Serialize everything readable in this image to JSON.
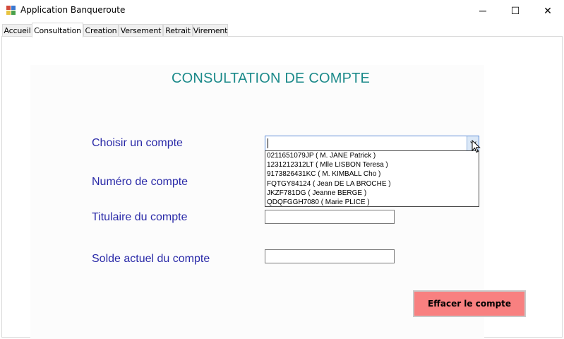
{
  "window": {
    "title": "Application Banqueroute",
    "minimize_glyph": "─",
    "maximize_glyph": "☐",
    "close_glyph": "✕"
  },
  "tabs": [
    {
      "label": "Accueil",
      "active": false
    },
    {
      "label": "Consultation",
      "active": true
    },
    {
      "label": "Creation",
      "active": false
    },
    {
      "label": "Versement",
      "active": false
    },
    {
      "label": "Retrait",
      "active": false
    },
    {
      "label": "Virement",
      "active": false
    }
  ],
  "consultation": {
    "heading": "CONSULTATION DE COMPTE",
    "choose_account_label": "Choisir un compte",
    "account_number_label": "Numéro de compte",
    "holder_label": "Titulaire du compte",
    "balance_label": "Solde actuel du compte",
    "account_combo_value": "",
    "account_options": [
      "0211651079JP ( M. JANE Patrick )",
      "1231212312LT ( Mlle LISBON Teresa )",
      "9173826431KC ( M. KIMBALL Cho )",
      "FQTGY84124 ( Jean DE LA BROCHE )",
      "JKZF781DG ( Jeanne BERGE )",
      "QDQFGGH7080 ( Marie PLICE )"
    ],
    "holder_value": "",
    "balance_value": "",
    "clear_button_label": "Effacer le compte"
  },
  "colors": {
    "heading": "#1c8a8a",
    "label": "#2a2aa8",
    "clear_button": "#f88080"
  },
  "icons": {
    "app": "app-icon",
    "dropdown": "chevron-down-icon",
    "cursor": "mouse-pointer-icon"
  }
}
